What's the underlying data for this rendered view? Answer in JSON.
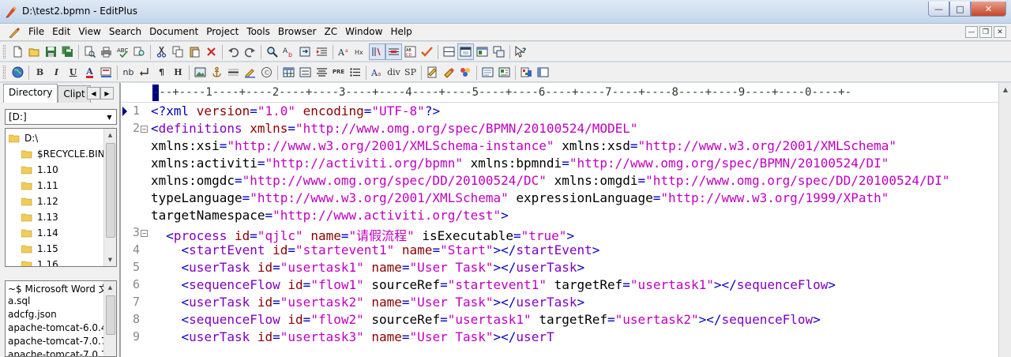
{
  "window": {
    "title": "D:\\test2.bpmn - EditPlus",
    "controls": [
      "minimize-icon",
      "maximize-icon",
      "close-icon"
    ]
  },
  "menu": {
    "items": [
      "File",
      "Edit",
      "View",
      "Search",
      "Document",
      "Project",
      "Tools",
      "Browser",
      "ZC",
      "Window",
      "Help"
    ]
  },
  "toolbar1": {
    "icons": [
      "new-file-icon",
      "open-folder-icon",
      "save-icon",
      "save-all-icon",
      "print-preview-icon",
      "print-icon",
      "spell-check-icon",
      "find-in-files-icon",
      "cut-icon",
      "copy-icon",
      "paste-icon",
      "delete-icon",
      "undo-icon",
      "redo-icon",
      "find-icon",
      "replace-icon",
      "goto-icon",
      "indent-icon",
      "font-icon",
      "hex-icon",
      "word-wrap-icon",
      "line-number-icon",
      "column-select-icon",
      "check-icon",
      "screen-split-icon",
      "fullscreen-icon",
      "window-icon",
      "tile-icon",
      "help-icon"
    ]
  },
  "toolbar2": {
    "icons": [
      "globe-icon",
      "bold-icon",
      "italic-icon",
      "underline-icon",
      "font-color-icon",
      "highlight-icon",
      "nbsp-icon",
      "br-icon",
      "paragraph-icon",
      "heading-icon",
      "image-icon",
      "anchor-icon",
      "hr-icon",
      "comment-icon",
      "special-char-icon",
      "table-icon",
      "form-icon",
      "center-icon",
      "pre-icon",
      "list-icon",
      "font-tag-icon",
      "div-icon",
      "span-icon",
      "html-toolbar-icon",
      "css-icon",
      "script-icon",
      "preview-icon",
      "validate-icon",
      "color-picker-icon",
      "browser-icon"
    ],
    "labels": {
      "bold": "B",
      "italic": "I",
      "underline": "U",
      "font_color": "A",
      "nbsp": "nb",
      "pre": "PRE",
      "div": "div",
      "sp": "SP",
      "heading": "H",
      "paragraph": "¶"
    }
  },
  "left_panel": {
    "tabs": [
      "Directory",
      "Clipt"
    ],
    "drive": "[D:]",
    "tree": [
      "D:\\",
      "$RECYCLE.BIN",
      "1.10",
      "1.11",
      "1.12",
      "1.13",
      "1.14",
      "1.15",
      "1.16"
    ],
    "files": [
      "~$ Microsoft Word 文",
      "a.sql",
      "adcfg.json",
      "apache-tomcat-6.0.4",
      "apache-tomcat-7.0.7",
      "apache-tomcat-7.0.7"
    ]
  },
  "editor": {
    "ruler": "---+----1----+----2----+----3----+----4----+----5----+----6----+----7----+----8----+----9----+----0----+-",
    "lines": [
      {
        "num": "1",
        "fold": "",
        "segs": [
          [
            "c-pun",
            "<?"
          ],
          [
            "c-tag",
            "xml "
          ],
          [
            "c-attr",
            "version"
          ],
          [
            "c-pun",
            "="
          ],
          [
            "c-val",
            "\"1.0\" "
          ],
          [
            "c-attr",
            "encoding"
          ],
          [
            "c-pun",
            "="
          ],
          [
            "c-val",
            "\"UTF-8\""
          ],
          [
            "c-pun",
            "?>"
          ]
        ]
      },
      {
        "num": "2",
        "fold": "⊟",
        "segs": [
          [
            "c-pun",
            "<"
          ],
          [
            "c-tag2",
            "definitions "
          ],
          [
            "c-attr",
            "xmlns"
          ],
          [
            "c-pun",
            "="
          ],
          [
            "c-val",
            "\"http://www.omg.org/spec/BPMN/20100524/MODEL\""
          ]
        ]
      },
      {
        "num": "",
        "fold": "",
        "segs": [
          [
            "c-plain",
            "xmlns:xsi"
          ],
          [
            "c-pun",
            "="
          ],
          [
            "c-val",
            "\"http://www.w3.org/2001/XMLSchema-instance\" "
          ],
          [
            "c-plain",
            "xmlns:xsd"
          ],
          [
            "c-pun",
            "="
          ],
          [
            "c-val",
            "\"http://www.w3.org/2001/XMLSchema\""
          ]
        ]
      },
      {
        "num": "",
        "fold": "",
        "segs": [
          [
            "c-plain",
            "xmlns:activiti"
          ],
          [
            "c-pun",
            "="
          ],
          [
            "c-val",
            "\"http://activiti.org/bpmn\" "
          ],
          [
            "c-plain",
            "xmlns:bpmndi"
          ],
          [
            "c-pun",
            "="
          ],
          [
            "c-val",
            "\"http://www.omg.org/spec/BPMN/20100524/DI\""
          ]
        ]
      },
      {
        "num": "",
        "fold": "",
        "segs": [
          [
            "c-plain",
            "xmlns:omgdc"
          ],
          [
            "c-pun",
            "="
          ],
          [
            "c-val",
            "\"http://www.omg.org/spec/DD/20100524/DC\" "
          ],
          [
            "c-plain",
            "xmlns:omgdi"
          ],
          [
            "c-pun",
            "="
          ],
          [
            "c-val",
            "\"http://www.omg.org/spec/DD/20100524/DI\""
          ]
        ]
      },
      {
        "num": "",
        "fold": "",
        "segs": [
          [
            "c-plain",
            "typeLanguage"
          ],
          [
            "c-pun",
            "="
          ],
          [
            "c-val",
            "\"http://www.w3.org/2001/XMLSchema\" "
          ],
          [
            "c-plain",
            "expressionLanguage"
          ],
          [
            "c-pun",
            "="
          ],
          [
            "c-val",
            "\"http://www.w3.org/1999/XPath\""
          ]
        ]
      },
      {
        "num": "",
        "fold": "",
        "segs": [
          [
            "c-plain",
            "targetNamespace"
          ],
          [
            "c-pun",
            "="
          ],
          [
            "c-val",
            "\"http://www.activiti.org/test\""
          ],
          [
            "c-pun",
            ">"
          ]
        ]
      },
      {
        "num": "3",
        "fold": "⊟",
        "segs": [
          [
            "c-plain",
            "  "
          ],
          [
            "c-pun",
            "<"
          ],
          [
            "c-tag2",
            "process "
          ],
          [
            "c-attr",
            "id"
          ],
          [
            "c-pun",
            "="
          ],
          [
            "c-val",
            "\"qjlc\" "
          ],
          [
            "c-attr",
            "name"
          ],
          [
            "c-pun",
            "="
          ],
          [
            "c-val",
            "\"请假流程\" "
          ],
          [
            "c-plain",
            "isExecutable"
          ],
          [
            "c-pun",
            "="
          ],
          [
            "c-val",
            "\"true\""
          ],
          [
            "c-pun",
            ">"
          ]
        ]
      },
      {
        "num": "4",
        "fold": "",
        "segs": [
          [
            "c-plain",
            "    "
          ],
          [
            "c-pun",
            "<"
          ],
          [
            "c-tag2",
            "startEvent "
          ],
          [
            "c-attr",
            "id"
          ],
          [
            "c-pun",
            "="
          ],
          [
            "c-val",
            "\"startevent1\" "
          ],
          [
            "c-attr",
            "name"
          ],
          [
            "c-pun",
            "="
          ],
          [
            "c-val",
            "\"Start\""
          ],
          [
            "c-pun",
            "></"
          ],
          [
            "c-tag2",
            "startEvent"
          ],
          [
            "c-pun",
            ">"
          ]
        ]
      },
      {
        "num": "5",
        "fold": "",
        "segs": [
          [
            "c-plain",
            "    "
          ],
          [
            "c-pun",
            "<"
          ],
          [
            "c-tag2",
            "userTask "
          ],
          [
            "c-attr",
            "id"
          ],
          [
            "c-pun",
            "="
          ],
          [
            "c-val",
            "\"usertask1\" "
          ],
          [
            "c-attr",
            "name"
          ],
          [
            "c-pun",
            "="
          ],
          [
            "c-val",
            "\"User Task\""
          ],
          [
            "c-pun",
            "></"
          ],
          [
            "c-tag2",
            "userTask"
          ],
          [
            "c-pun",
            ">"
          ]
        ]
      },
      {
        "num": "6",
        "fold": "",
        "segs": [
          [
            "c-plain",
            "    "
          ],
          [
            "c-pun",
            "<"
          ],
          [
            "c-tag2",
            "sequenceFlow "
          ],
          [
            "c-attr",
            "id"
          ],
          [
            "c-pun",
            "="
          ],
          [
            "c-val",
            "\"flow1\" "
          ],
          [
            "c-plain",
            "sourceRef"
          ],
          [
            "c-pun",
            "="
          ],
          [
            "c-val",
            "\"startevent1\" "
          ],
          [
            "c-plain",
            "targetRef"
          ],
          [
            "c-pun",
            "="
          ],
          [
            "c-val",
            "\"usertask1\""
          ],
          [
            "c-pun",
            "></"
          ],
          [
            "c-tag2",
            "sequenceFlow"
          ],
          [
            "c-pun",
            ">"
          ]
        ]
      },
      {
        "num": "7",
        "fold": "",
        "segs": [
          [
            "c-plain",
            "    "
          ],
          [
            "c-pun",
            "<"
          ],
          [
            "c-tag2",
            "userTask "
          ],
          [
            "c-attr",
            "id"
          ],
          [
            "c-pun",
            "="
          ],
          [
            "c-val",
            "\"usertask2\" "
          ],
          [
            "c-attr",
            "name"
          ],
          [
            "c-pun",
            "="
          ],
          [
            "c-val",
            "\"User Task\""
          ],
          [
            "c-pun",
            "></"
          ],
          [
            "c-tag2",
            "userTask"
          ],
          [
            "c-pun",
            ">"
          ]
        ]
      },
      {
        "num": "8",
        "fold": "",
        "segs": [
          [
            "c-plain",
            "    "
          ],
          [
            "c-pun",
            "<"
          ],
          [
            "c-tag2",
            "sequenceFlow "
          ],
          [
            "c-attr",
            "id"
          ],
          [
            "c-pun",
            "="
          ],
          [
            "c-val",
            "\"flow2\" "
          ],
          [
            "c-plain",
            "sourceRef"
          ],
          [
            "c-pun",
            "="
          ],
          [
            "c-val",
            "\"usertask1\" "
          ],
          [
            "c-plain",
            "targetRef"
          ],
          [
            "c-pun",
            "="
          ],
          [
            "c-val",
            "\"usertask2\""
          ],
          [
            "c-pun",
            "></"
          ],
          [
            "c-tag2",
            "sequenceFlow"
          ],
          [
            "c-pun",
            ">"
          ]
        ]
      },
      {
        "num": "9",
        "fold": "",
        "segs": [
          [
            "c-plain",
            "    "
          ],
          [
            "c-pun",
            "<"
          ],
          [
            "c-tag2",
            "userTask "
          ],
          [
            "c-attr",
            "id"
          ],
          [
            "c-pun",
            "="
          ],
          [
            "c-val",
            "\"usertask3\" "
          ],
          [
            "c-attr",
            "name"
          ],
          [
            "c-pun",
            "="
          ],
          [
            "c-val",
            "\"User Task\""
          ],
          [
            "c-pun",
            "></"
          ],
          [
            "c-tag2",
            "userT"
          ]
        ]
      }
    ]
  },
  "colors": {
    "tag": "#0000c0",
    "element": "#8000c0",
    "attribute": "#8b0000",
    "value": "#c000c0"
  }
}
